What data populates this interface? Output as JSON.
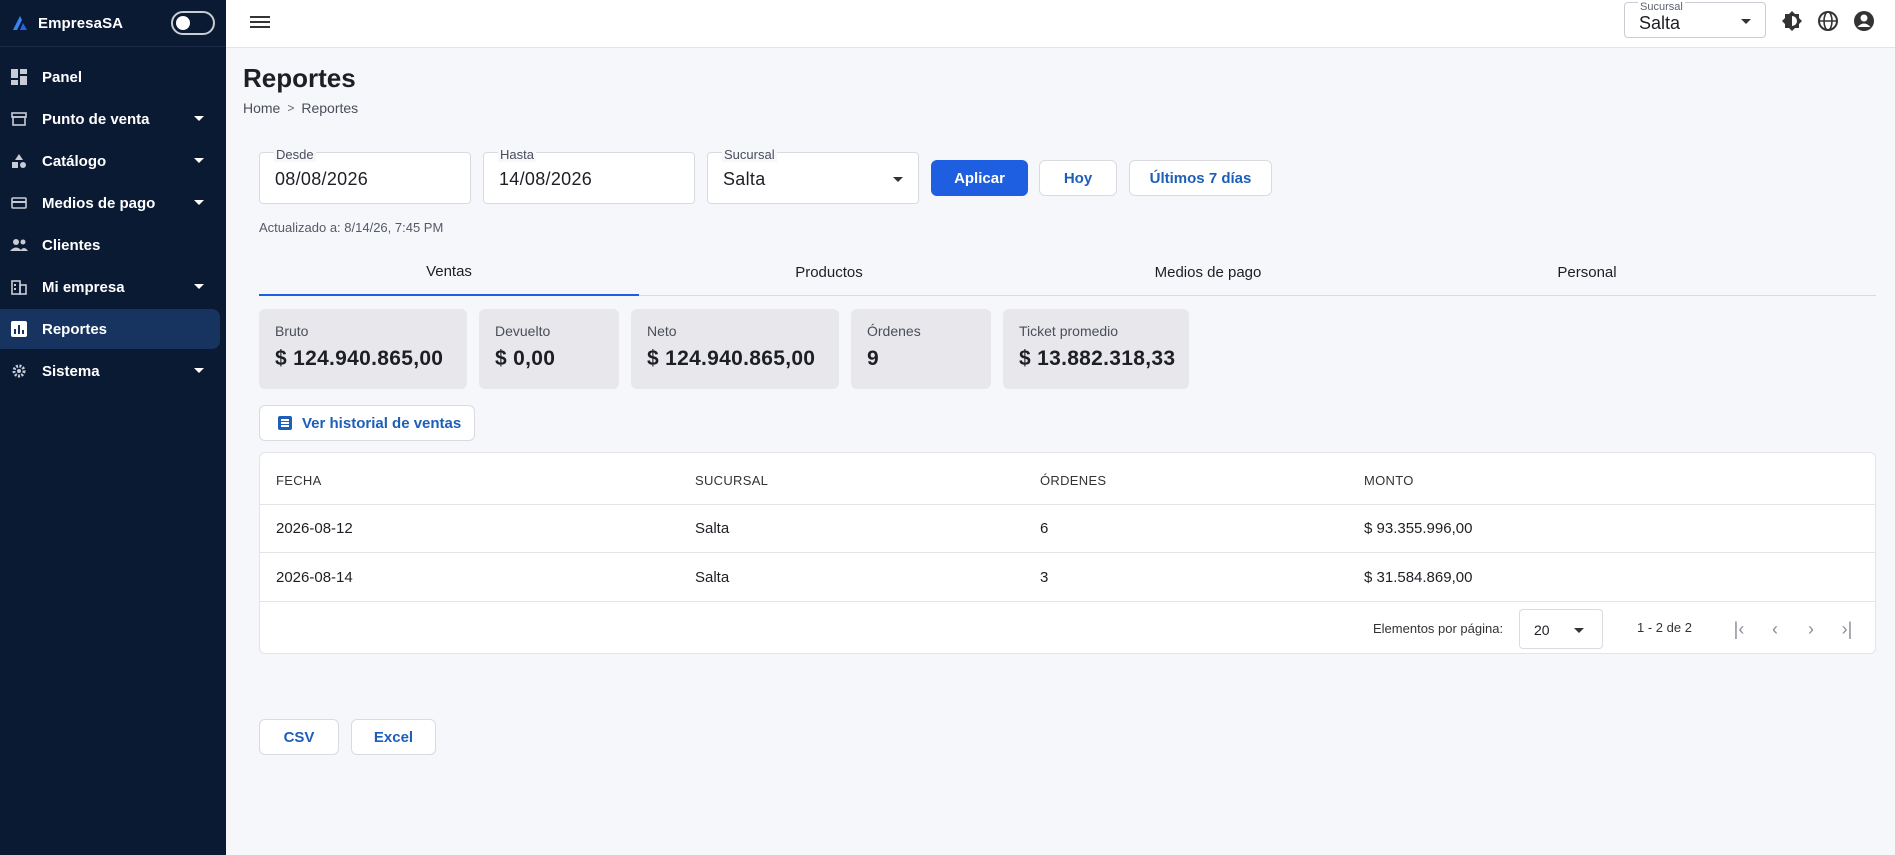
{
  "app": {
    "brand": "EmpresaSA"
  },
  "sidebar": {
    "items": [
      {
        "label": "Panel",
        "icon": "dashboard-icon",
        "expandable": false,
        "active": false
      },
      {
        "label": "Punto de venta",
        "icon": "store-icon",
        "expandable": true,
        "active": false
      },
      {
        "label": "Catálogo",
        "icon": "category-icon",
        "expandable": true,
        "active": false
      },
      {
        "label": "Medios de pago",
        "icon": "credit-card-icon",
        "expandable": true,
        "active": false
      },
      {
        "label": "Clientes",
        "icon": "people-icon",
        "expandable": false,
        "active": false
      },
      {
        "label": "Mi empresa",
        "icon": "building-icon",
        "expandable": true,
        "active": false
      },
      {
        "label": "Reportes",
        "icon": "bar-chart-icon",
        "expandable": false,
        "active": true
      },
      {
        "label": "Sistema",
        "icon": "gear-icon",
        "expandable": true,
        "active": false
      }
    ]
  },
  "topbar": {
    "branch_label": "Sucursal",
    "branch_value": "Salta"
  },
  "page": {
    "title": "Reportes",
    "breadcrumb": [
      "Home",
      "Reportes"
    ]
  },
  "filters": {
    "desde_label": "Desde",
    "desde_value": "08/08/2026",
    "hasta_label": "Hasta",
    "hasta_value": "14/08/2026",
    "sucursal_label": "Sucursal",
    "sucursal_value": "Salta",
    "apply_label": "Aplicar",
    "today_label": "Hoy",
    "last7_label": "Últimos 7 días"
  },
  "updated": "Actualizado a: 8/14/26, 7:45 PM",
  "tabs": [
    "Ventas",
    "Productos",
    "Medios de pago",
    "Personal"
  ],
  "summary": [
    {
      "label": "Bruto",
      "value": "$ 124.940.865,00"
    },
    {
      "label": "Devuelto",
      "value": "$ 0,00"
    },
    {
      "label": "Neto",
      "value": "$ 124.940.865,00"
    },
    {
      "label": "Órdenes",
      "value": "9"
    },
    {
      "label": "Ticket promedio",
      "value": "$ 13.882.318,33"
    }
  ],
  "history_button": "Ver historial de ventas",
  "table": {
    "columns": [
      "FECHA",
      "SUCURSAL",
      "ÓRDENES",
      "MONTO"
    ],
    "rows": [
      [
        "2026-08-12",
        "Salta",
        "6",
        "$ 93.355.996,00"
      ],
      [
        "2026-08-14",
        "Salta",
        "3",
        "$ 31.584.869,00"
      ]
    ],
    "page_size_label": "Elementos por página:",
    "page_size": "20",
    "range": "1 - 2 de 2"
  },
  "export": {
    "csv": "CSV",
    "excel": "Excel"
  },
  "colors": {
    "sidebar": "#0b1a33",
    "accent": "#1d5fe0",
    "active_item": "#17335f"
  }
}
